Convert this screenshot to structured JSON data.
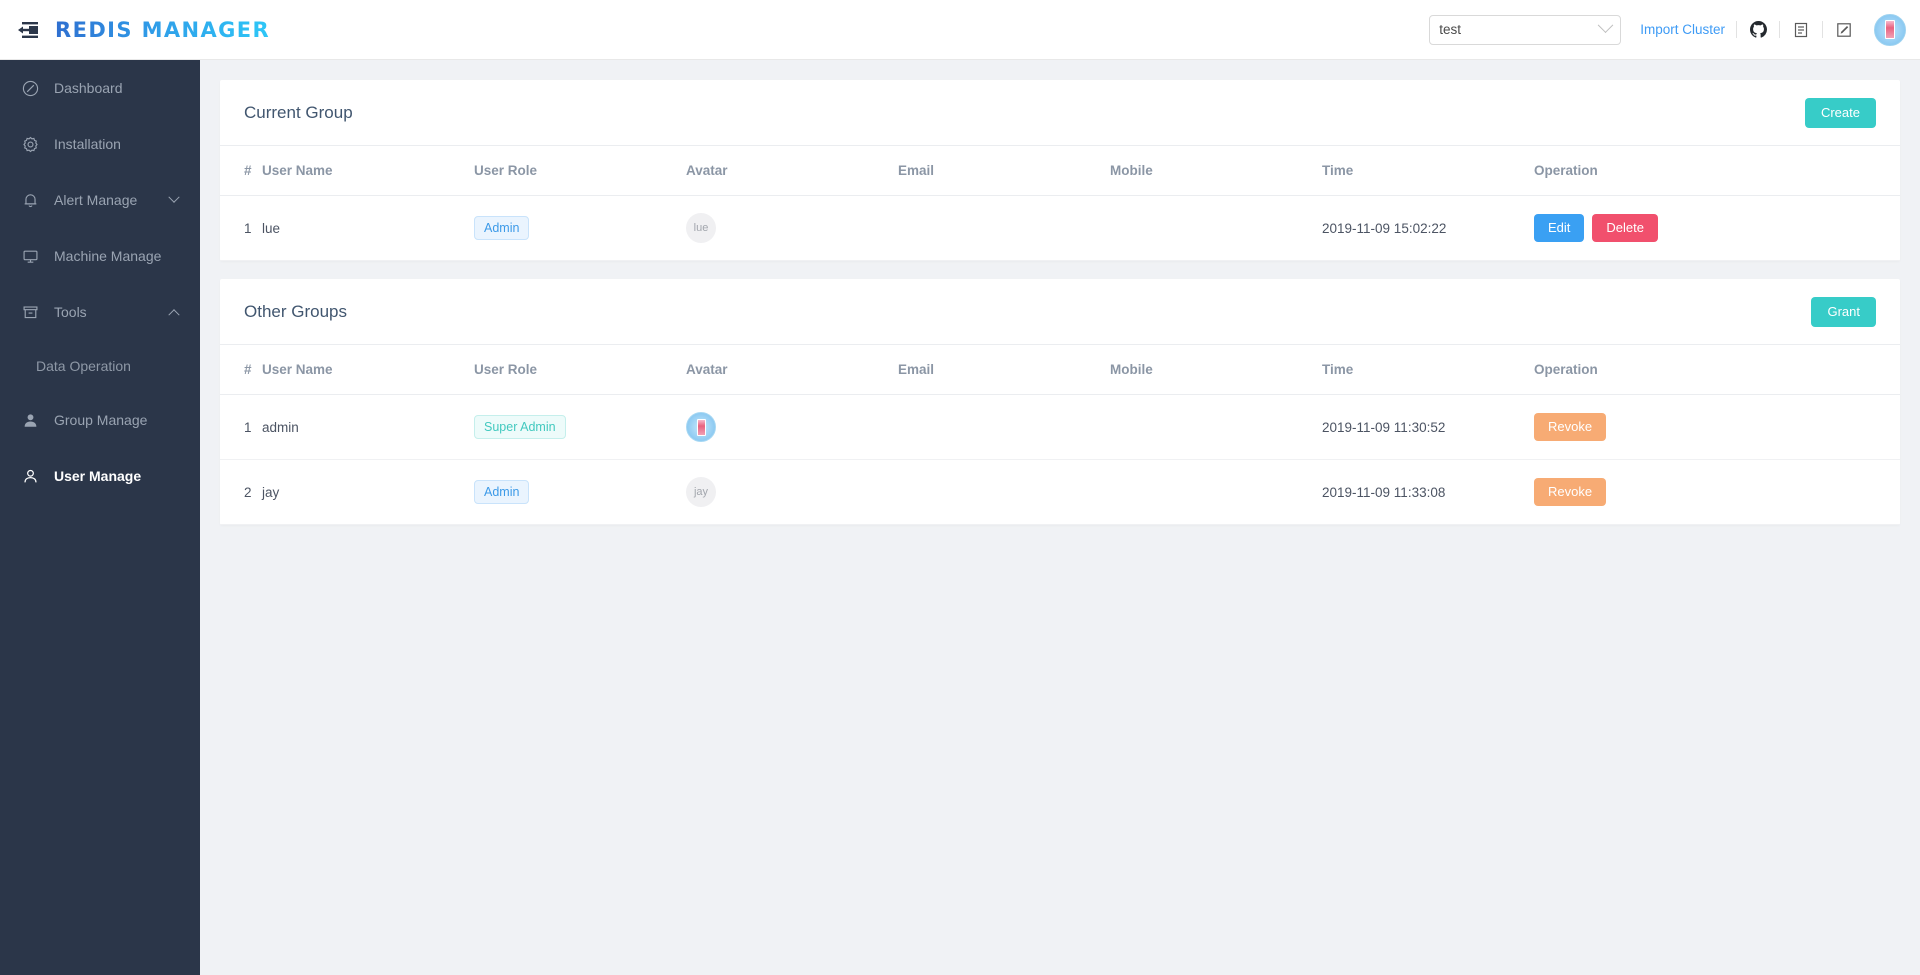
{
  "header": {
    "menu_icon": "menu-fold-icon",
    "brand": "REDIS MANAGER",
    "cluster_select": {
      "value": "test",
      "icon": "chevron-down-icon"
    },
    "import_link": "Import Cluster",
    "icons": [
      "github-icon",
      "document-icon",
      "edit-icon"
    ],
    "avatar": "user-avatar"
  },
  "sidebar": {
    "items": [
      {
        "label": "Dashboard",
        "icon": "dashboard-icon",
        "active": false,
        "caret": ""
      },
      {
        "label": "Installation",
        "icon": "gear-icon",
        "active": false,
        "caret": ""
      },
      {
        "label": "Alert Manage",
        "icon": "bell-icon",
        "active": false,
        "caret": "down"
      },
      {
        "label": "Machine Manage",
        "icon": "monitor-icon",
        "active": false,
        "caret": ""
      },
      {
        "label": "Tools",
        "icon": "tools-box-icon",
        "active": false,
        "caret": "up"
      },
      {
        "label": "Data Operation",
        "icon": "",
        "active": false,
        "caret": "",
        "sub": true
      },
      {
        "label": "Group Manage",
        "icon": "user-filled-icon",
        "active": false,
        "caret": ""
      },
      {
        "label": "User Manage",
        "icon": "user-outline-icon",
        "active": true,
        "caret": ""
      }
    ]
  },
  "main": {
    "current_group": {
      "title": "Current Group",
      "action_label": "Create",
      "columns": [
        "#",
        "User Name",
        "User Role",
        "Avatar",
        "Email",
        "Mobile",
        "Time",
        "Operation"
      ],
      "rows": [
        {
          "index": "1",
          "user_name": "lue",
          "role": "Admin",
          "role_type": "admin",
          "avatar_text": "lue",
          "avatar_type": "text",
          "email": "",
          "mobile": "",
          "time": "2019-11-09 15:02:22",
          "actions": [
            "Edit",
            "Delete"
          ]
        }
      ]
    },
    "other_groups": {
      "title": "Other Groups",
      "action_label": "Grant",
      "columns": [
        "#",
        "User Name",
        "User Role",
        "Avatar",
        "Email",
        "Mobile",
        "Time",
        "Operation"
      ],
      "rows": [
        {
          "index": "1",
          "user_name": "admin",
          "role": "Super Admin",
          "role_type": "super",
          "avatar_text": "",
          "avatar_type": "image",
          "email": "",
          "mobile": "",
          "time": "2019-11-09 11:30:52",
          "actions": [
            "Revoke"
          ]
        },
        {
          "index": "2",
          "user_name": "jay",
          "role": "Admin",
          "role_type": "admin",
          "avatar_text": "jay",
          "avatar_type": "text",
          "email": "",
          "mobile": "",
          "time": "2019-11-09 11:33:08",
          "actions": [
            "Revoke"
          ]
        }
      ]
    }
  },
  "colors": {
    "brand_start": "#2f6fd0",
    "brand_end": "#2ec7f7",
    "sidebar_bg": "#2b3649",
    "page_bg": "#f0f2f5",
    "teal": "#37ccc8",
    "blue": "#3aa0f3",
    "red": "#f1506d",
    "orange": "#f7ab74",
    "link": "#3e9bf5"
  }
}
